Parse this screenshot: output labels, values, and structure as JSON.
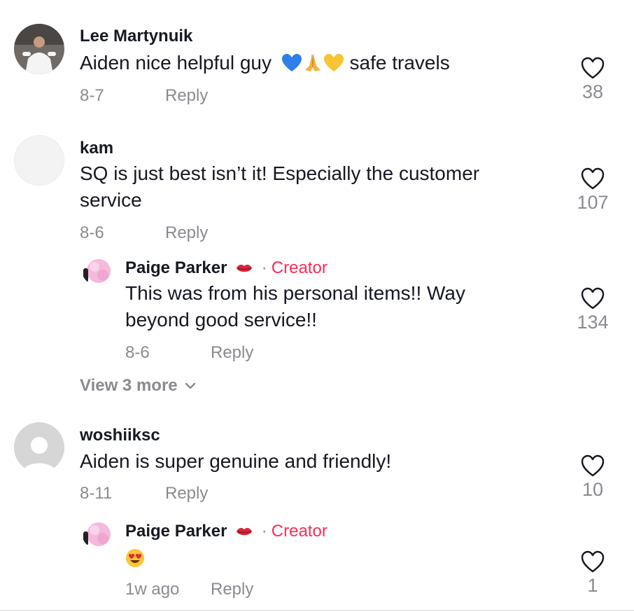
{
  "comments": [
    {
      "username": "Lee Martynuik",
      "text": "Aiden nice helpful guy",
      "text_suffix": "safe travels",
      "emojis": [
        "blue-heart",
        "folded-hands",
        "yellow-heart"
      ],
      "date": "8-7",
      "reply_label": "Reply",
      "likes": "38"
    },
    {
      "username": "kam",
      "text": "SQ is just best isn’t it! Especially the customer service",
      "date": "8-6",
      "reply_label": "Reply",
      "likes": "107",
      "replies": [
        {
          "username": "Paige Parker",
          "badge": "Creator",
          "separator": "·",
          "text": "This was from his personal items!! Way beyond good service!!",
          "date": "8-6",
          "reply_label": "Reply",
          "likes": "134"
        }
      ],
      "view_more_label": "View 3 more"
    },
    {
      "username": "woshiiksc",
      "text": "Aiden is super genuine and friendly!",
      "date": "8-11",
      "reply_label": "Reply",
      "likes": "10",
      "replies": [
        {
          "username": "Paige Parker",
          "badge": "Creator",
          "separator": "·",
          "emoji": "heart-eyes",
          "date": "1w ago",
          "reply_label": "Reply",
          "likes": "1"
        }
      ]
    }
  ],
  "colors": {
    "primary_text": "#161823",
    "secondary_text": "#8a8b91",
    "creator_accent": "#fe2c55"
  },
  "icons": {
    "like": "heart-outline-icon",
    "expand": "chevron-down-icon",
    "creator_badge": "lips-icon"
  }
}
